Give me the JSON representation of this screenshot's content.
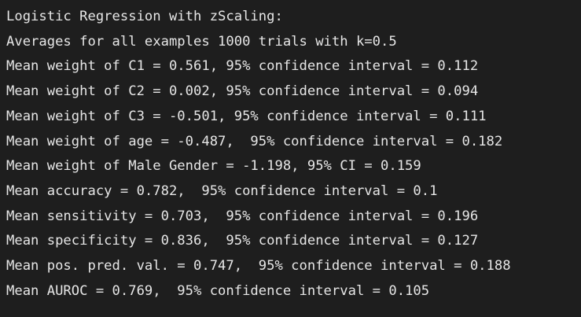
{
  "terminal": {
    "lines": [
      "Logistic Regression with zScaling:",
      "Averages for all examples 1000 trials with k=0.5",
      "Mean weight of C1 = 0.561, 95% confidence interval = 0.112",
      "Mean weight of C2 = 0.002, 95% confidence interval = 0.094",
      "Mean weight of C3 = -0.501, 95% confidence interval = 0.111",
      "Mean weight of age = -0.487,  95% confidence interval = 0.182",
      "Mean weight of Male Gender = -1.198, 95% CI = 0.159",
      "Mean accuracy = 0.782,  95% confidence interval = 0.1",
      "Mean sensitivity = 0.703,  95% confidence interval = 0.196",
      "Mean specificity = 0.836,  95% confidence interval = 0.127",
      "Mean pos. pred. val. = 0.747,  95% confidence interval = 0.188",
      "Mean AUROC = 0.769,  95% confidence interval = 0.105"
    ]
  }
}
